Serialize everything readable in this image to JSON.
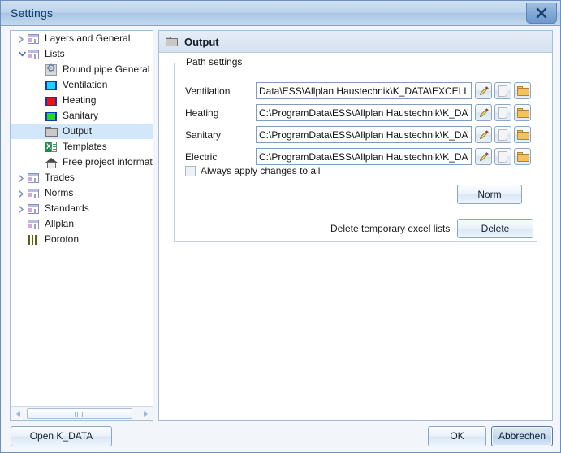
{
  "window": {
    "title": "Settings",
    "close_icon": "close-icon"
  },
  "tree": {
    "items": [
      {
        "label": "Layers and General",
        "icon": "page-icon",
        "indent": 0,
        "expander": "collapsed",
        "selected": false
      },
      {
        "label": "Lists",
        "icon": "page-icon",
        "indent": 0,
        "expander": "expanded",
        "selected": false
      },
      {
        "label": "Round pipe General",
        "icon": "gear-icon",
        "indent": 1,
        "expander": "none",
        "selected": false
      },
      {
        "label": "Ventilation",
        "icon": "duct-vent-icon",
        "indent": 1,
        "expander": "none",
        "selected": false
      },
      {
        "label": "Heating",
        "icon": "duct-heat-icon",
        "indent": 1,
        "expander": "none",
        "selected": false
      },
      {
        "label": "Sanitary",
        "icon": "duct-sanitary-icon",
        "indent": 1,
        "expander": "none",
        "selected": false
      },
      {
        "label": "Output",
        "icon": "folder-icon",
        "indent": 1,
        "expander": "none",
        "selected": true
      },
      {
        "label": "Templates",
        "icon": "excel-icon",
        "indent": 1,
        "expander": "none",
        "selected": false
      },
      {
        "label": "Free project informat",
        "icon": "house-icon",
        "indent": 1,
        "expander": "none",
        "selected": false
      },
      {
        "label": "Trades",
        "icon": "page-icon",
        "indent": 0,
        "expander": "collapsed",
        "selected": false
      },
      {
        "label": "Norms",
        "icon": "page-icon",
        "indent": 0,
        "expander": "collapsed",
        "selected": false
      },
      {
        "label": "Standards",
        "icon": "page-icon",
        "indent": 0,
        "expander": "collapsed",
        "selected": false
      },
      {
        "label": "Allplan",
        "icon": "page-icon",
        "indent": 0,
        "expander": "none",
        "selected": false
      },
      {
        "label": "Poroton",
        "icon": "brick-icon",
        "indent": 0,
        "expander": "none",
        "selected": false
      }
    ],
    "scrollbar": {
      "left_arrow": "arrow-left-icon",
      "right_arrow": "arrow-right-icon"
    }
  },
  "panel": {
    "title": "Output",
    "title_icon": "folder-icon",
    "group": {
      "legend": "Path settings",
      "rows": [
        {
          "label": "Ventilation",
          "value": "Data\\ESS\\Allplan Haustechnik\\K_DATA\\EXCELLIST",
          "edit_icon": "pencil-icon",
          "doc_icon": "document-icon",
          "browse_icon": "folder-open-icon"
        },
        {
          "label": "Heating",
          "value": "C:\\ProgramData\\ESS\\Allplan Haustechnik\\K_DATA\\E",
          "edit_icon": "pencil-icon",
          "doc_icon": "document-icon",
          "browse_icon": "folder-open-icon"
        },
        {
          "label": "Sanitary",
          "value": "C:\\ProgramData\\ESS\\Allplan Haustechnik\\K_DATA\\E",
          "edit_icon": "pencil-icon",
          "doc_icon": "document-icon",
          "browse_icon": "folder-open-icon"
        },
        {
          "label": "Electric",
          "value": "C:\\ProgramData\\ESS\\Allplan Haustechnik\\K_DATA\\E",
          "edit_icon": "pencil-icon",
          "doc_icon": "document-icon",
          "browse_icon": "folder-open-icon"
        }
      ],
      "checkbox": {
        "label": "Always apply changes to all",
        "checked": false
      },
      "norm_button": "Norm",
      "delete_caption": "Delete temporary excel lists",
      "delete_button": "Delete"
    }
  },
  "footer": {
    "open_kdata": "Open K_DATA",
    "ok": "OK",
    "cancel": "Abbrechen"
  },
  "colors": {
    "title_bar": "#bdd4ec",
    "selection": "#d3e7fa",
    "accent_border": "#7fa3cc",
    "vent": "#19d6f2",
    "heat": "#e81414",
    "sanitary": "#1ddd1d",
    "folder": "#f3c15e"
  }
}
